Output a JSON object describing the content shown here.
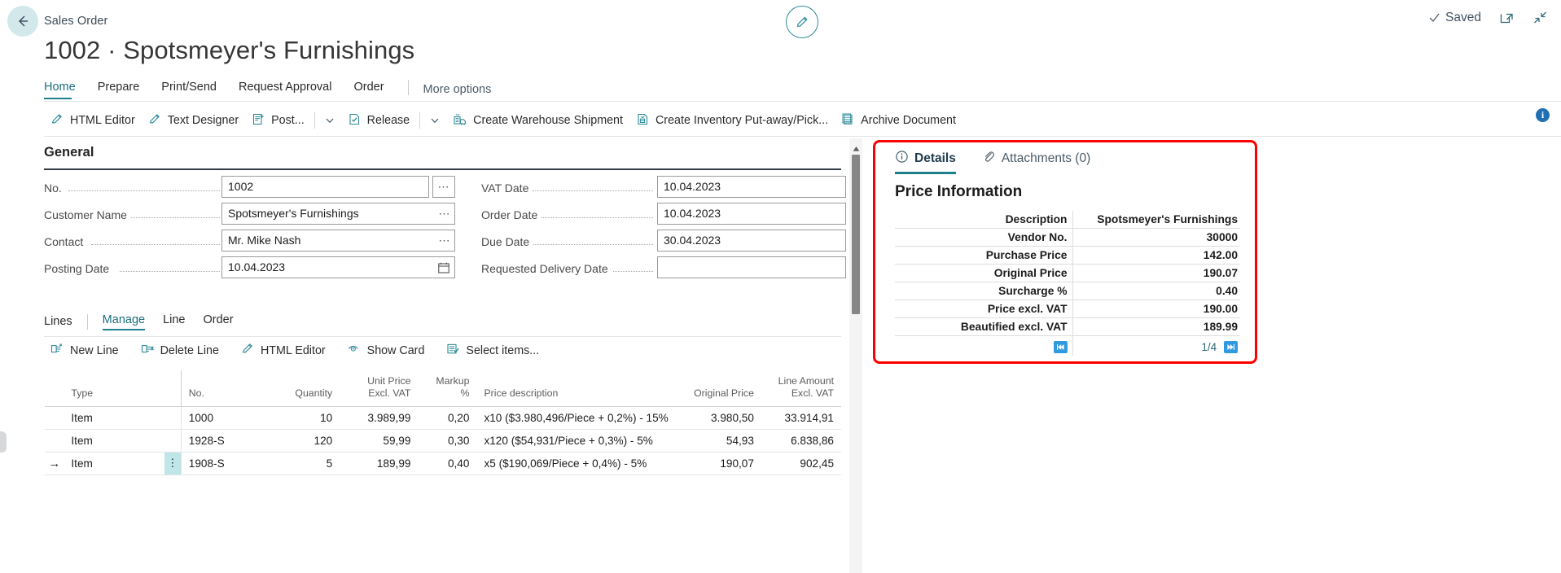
{
  "header": {
    "breadcrumb": "Sales Order",
    "title": "1002 · Spotsmeyer's Furnishings",
    "saved_label": "Saved",
    "back_icon": "back-arrow-icon",
    "edit_icon": "pencil-icon",
    "open_new_window_icon": "open-in-new-window-icon",
    "collapse_icon": "collapse-icon"
  },
  "menu": {
    "items": [
      {
        "label": "Home",
        "active": true
      },
      {
        "label": "Prepare",
        "active": false
      },
      {
        "label": "Print/Send",
        "active": false
      },
      {
        "label": "Request Approval",
        "active": false
      },
      {
        "label": "Order",
        "active": false
      }
    ],
    "more_options": "More options"
  },
  "toolbar": {
    "actions": [
      {
        "label": "HTML Editor",
        "icon": "pencil-icon",
        "caret": false
      },
      {
        "label": "Text Designer",
        "icon": "pencil-icon",
        "caret": false
      },
      {
        "label": "Post...",
        "icon": "post-document-icon",
        "caret": true
      },
      {
        "label": "Release",
        "icon": "release-document-icon",
        "caret": true
      },
      {
        "label": "Create Warehouse Shipment",
        "icon": "warehouse-shipment-icon",
        "caret": false
      },
      {
        "label": "Create Inventory Put-away/Pick...",
        "icon": "inventory-putaway-icon",
        "caret": false
      },
      {
        "label": "Archive Document",
        "icon": "archive-document-icon",
        "caret": false
      }
    ],
    "info_badge": "i"
  },
  "general": {
    "section_title": "General",
    "left_fields": [
      {
        "label": "No.",
        "value": "1002",
        "widget": "assist-edit"
      },
      {
        "label": "Customer Name",
        "value": "Spotsmeyer's Furnishings",
        "widget": "inline-ellipsis"
      },
      {
        "label": "Contact",
        "value": "Mr. Mike Nash",
        "widget": "inline-ellipsis"
      },
      {
        "label": "Posting Date",
        "value": "10.04.2023",
        "widget": "calendar"
      }
    ],
    "right_fields": [
      {
        "label": "VAT Date",
        "value": "10.04.2023",
        "widget": "none"
      },
      {
        "label": "Order Date",
        "value": "10.04.2023",
        "widget": "none"
      },
      {
        "label": "Due Date",
        "value": "30.04.2023",
        "widget": "none"
      },
      {
        "label": "Requested Delivery Date",
        "value": "",
        "widget": "none"
      }
    ]
  },
  "lines": {
    "word": "Lines",
    "tabs": [
      {
        "label": "Manage",
        "active": true
      },
      {
        "label": "Line",
        "active": false
      },
      {
        "label": "Order",
        "active": false
      }
    ],
    "actions": [
      {
        "label": "New Line",
        "icon": "new-line-icon"
      },
      {
        "label": "Delete Line",
        "icon": "delete-line-icon"
      },
      {
        "label": "HTML Editor",
        "icon": "pencil-icon"
      },
      {
        "label": "Show Card",
        "icon": "show-card-icon"
      },
      {
        "label": "Select items...",
        "icon": "select-items-icon"
      }
    ],
    "columns": [
      "Type",
      "No.",
      "Quantity",
      "Unit Price Excl. VAT",
      "Markup %",
      "Price description",
      "Original Price",
      "Line Amount Excl. VAT"
    ],
    "rows": [
      {
        "selected": false,
        "type": "Item",
        "no": "1000",
        "quantity": "10",
        "unit_price": "3.989,99",
        "markup": "0,20",
        "price_description": "x10 ($3.980,496/Piece + 0,2%) - 15%",
        "original_price": "3.980,50",
        "line_amount": "33.914,91"
      },
      {
        "selected": false,
        "type": "Item",
        "no": "1928-S",
        "quantity": "120",
        "unit_price": "59,99",
        "markup": "0,30",
        "price_description": "x120 ($54,931/Piece + 0,3%) - 5%",
        "original_price": "54,93",
        "line_amount": "6.838,86"
      },
      {
        "selected": true,
        "type": "Item",
        "no": "1908-S",
        "quantity": "5",
        "unit_price": "189,99",
        "markup": "0,40",
        "price_description": "x5 ($190,069/Piece + 0,4%) - 5%",
        "original_price": "190,07",
        "line_amount": "902,45"
      }
    ]
  },
  "factbox": {
    "tabs": [
      {
        "label": "Details",
        "icon": "info-circle-icon",
        "active": true
      },
      {
        "label": "Attachments (0)",
        "icon": "paperclip-icon",
        "active": false
      }
    ],
    "title": "Price Information",
    "rows": [
      {
        "key": "Description",
        "value": "Spotsmeyer's Furnishings"
      },
      {
        "key": "Vendor No.",
        "value": "30000"
      },
      {
        "key": "Purchase Price",
        "value": "142.00"
      },
      {
        "key": "Original Price",
        "value": "190.07"
      },
      {
        "key": "Surcharge %",
        "value": "0.40"
      },
      {
        "key": "Price excl. VAT",
        "value": "190.00"
      },
      {
        "key": "Beautified excl. VAT",
        "value": "189.99"
      }
    ],
    "nav": {
      "first_label": "⏮",
      "last_label": "⏭",
      "count": "1/4"
    },
    "highlight_color": "#ff0000"
  }
}
